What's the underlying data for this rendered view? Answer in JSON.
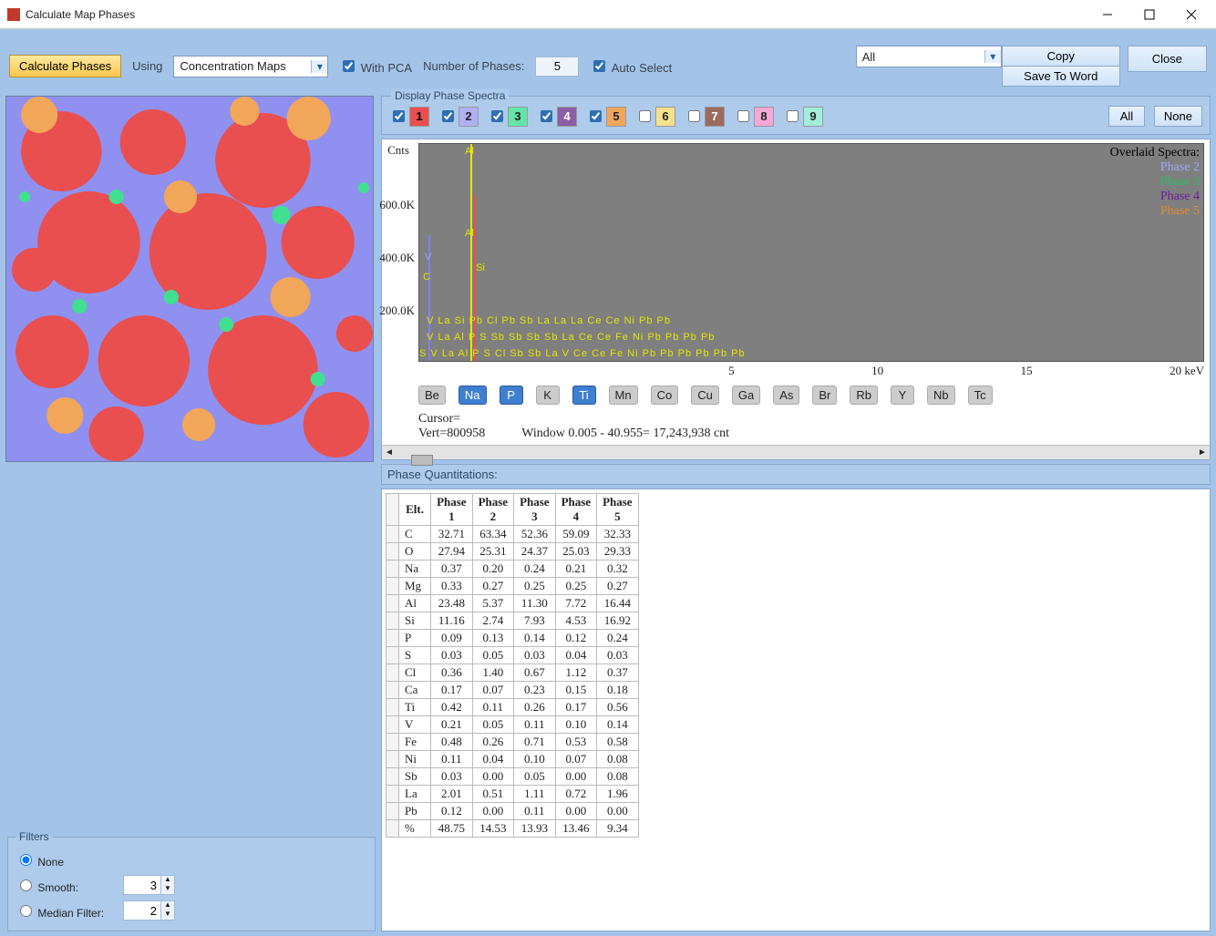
{
  "window": {
    "title": "Calculate Map Phases"
  },
  "toolbar": {
    "calculate_btn": "Calculate Phases",
    "using_lbl": "Using",
    "using_value": "Concentration Maps",
    "with_pca_lbl": "With PCA",
    "num_phases_lbl": "Number of Phases:",
    "num_phases_val": "5",
    "auto_select_lbl": "Auto Select",
    "results_select": "All",
    "copy_btn": "Copy",
    "save_btn": "Save To Word",
    "close_btn": "Close"
  },
  "display_group": {
    "title": "Display Phase Spectra",
    "all_btn": "All",
    "none_btn": "None",
    "phases": [
      {
        "n": "1",
        "checked": true
      },
      {
        "n": "2",
        "checked": true
      },
      {
        "n": "3",
        "checked": true
      },
      {
        "n": "4",
        "checked": true
      },
      {
        "n": "5",
        "checked": true
      },
      {
        "n": "6",
        "checked": false
      },
      {
        "n": "7",
        "checked": false
      },
      {
        "n": "8",
        "checked": false
      },
      {
        "n": "9",
        "checked": false
      }
    ]
  },
  "spectrum": {
    "ytitle": "Cnts",
    "yticks": [
      "600.0K",
      "400.0K",
      "200.0K"
    ],
    "xticks": [
      "5",
      "10",
      "15",
      "20 keV"
    ],
    "legend_title": "Overlaid Spectra:",
    "legend": {
      "p2": "Phase 2",
      "p3": "Phase 3",
      "p4": "Phase 4",
      "p5": "Phase 5"
    },
    "annot_al": "Al",
    "annot_si": "Si",
    "annot_v": "V",
    "annot_c": "C",
    "row1": "V La   Si Pb Cl Pb Sb   La La La Ce  Ce      Ni                                   Pb                    Pb",
    "row2": "V La  Al P S   Sb Sb   Sb Sb La Ce  Ce    Fe     Ni           Pb        Pb        Pb                    Pb",
    "row3": "S V La  Al P S  Cl  Sb Sb   La V Ce  Ce    Fe     Ni     Pb    Pb   Pb   Pb  Pb           Pb",
    "elements": [
      "Be",
      "Na",
      "P",
      "K",
      "Ti",
      "Mn",
      "Co",
      "Cu",
      "Ga",
      "As",
      "Br",
      "Rb",
      "Y",
      "Nb",
      "Tc"
    ],
    "elem_active": [
      "Na",
      "P",
      "Ti"
    ],
    "cursor_lbl": "Cursor=",
    "vert_lbl": "Vert=800958",
    "window_lbl": "Window 0.005 - 40.955=   17,243,938 cnt"
  },
  "filters": {
    "title": "Filters",
    "none_lbl": "None",
    "smooth_lbl": "Smooth:",
    "smooth_val": "3",
    "median_lbl": "Median Filter:",
    "median_val": "2"
  },
  "quant": {
    "title": "Phase Quantitations:",
    "headers": [
      "Elt.",
      "Phase 1",
      "Phase 2",
      "Phase 3",
      "Phase 4",
      "Phase 5"
    ],
    "rows": [
      [
        "C",
        "32.71",
        "63.34",
        "52.36",
        "59.09",
        "32.33"
      ],
      [
        "O",
        "27.94",
        "25.31",
        "24.37",
        "25.03",
        "29.33"
      ],
      [
        "Na",
        "0.37",
        "0.20",
        "0.24",
        "0.21",
        "0.32"
      ],
      [
        "Mg",
        "0.33",
        "0.27",
        "0.25",
        "0.25",
        "0.27"
      ],
      [
        "Al",
        "23.48",
        "5.37",
        "11.30",
        "7.72",
        "16.44"
      ],
      [
        "Si",
        "11.16",
        "2.74",
        "7.93",
        "4.53",
        "16.92"
      ],
      [
        "P",
        "0.09",
        "0.13",
        "0.14",
        "0.12",
        "0.24"
      ],
      [
        "S",
        "0.03",
        "0.05",
        "0.03",
        "0.04",
        "0.03"
      ],
      [
        "Cl",
        "0.36",
        "1.40",
        "0.67",
        "1.12",
        "0.37"
      ],
      [
        "Ca",
        "0.17",
        "0.07",
        "0.23",
        "0.15",
        "0.18"
      ],
      [
        "Ti",
        "0.42",
        "0.11",
        "0.26",
        "0.17",
        "0.56"
      ],
      [
        "V",
        "0.21",
        "0.05",
        "0.11",
        "0.10",
        "0.14"
      ],
      [
        "Fe",
        "0.48",
        "0.26",
        "0.71",
        "0.53",
        "0.58"
      ],
      [
        "Ni",
        "0.11",
        "0.04",
        "0.10",
        "0.07",
        "0.08"
      ],
      [
        "Sb",
        "0.03",
        "0.00",
        "0.05",
        "0.00",
        "0.08"
      ],
      [
        "La",
        "2.01",
        "0.51",
        "1.11",
        "0.72",
        "1.96"
      ],
      [
        "Pb",
        "0.12",
        "0.00",
        "0.11",
        "0.00",
        "0.00"
      ],
      [
        "%",
        "48.75",
        "14.53",
        "13.93",
        "13.46",
        "9.34"
      ]
    ]
  },
  "chart_data": {
    "type": "line",
    "title": "Overlaid Spectra",
    "xlabel": "keV",
    "ylabel": "Cnts",
    "xlim": [
      0,
      20
    ],
    "ylim": [
      0,
      700000
    ],
    "series": [
      {
        "name": "Phase 2",
        "color": "#a5a5ff"
      },
      {
        "name": "Phase 3",
        "color": "#20c060"
      },
      {
        "name": "Phase 4",
        "color": "#6a1b9a"
      },
      {
        "name": "Phase 5",
        "color": "#e08a30"
      }
    ],
    "peaks": [
      {
        "label": "Al",
        "x_approx": 1.49,
        "y_approx": 700000
      },
      {
        "label": "Al",
        "x_approx": 1.49,
        "y_approx": 380000
      },
      {
        "label": "Si",
        "x_approx": 1.74,
        "y_approx": 260000
      },
      {
        "label": "V",
        "x_approx": 0.51,
        "y_approx": 300000
      },
      {
        "label": "C",
        "x_approx": 0.28,
        "y_approx": 200000
      }
    ],
    "vert": 800958,
    "window": {
      "low": 0.005,
      "high": 40.955,
      "counts": 17243938
    }
  }
}
